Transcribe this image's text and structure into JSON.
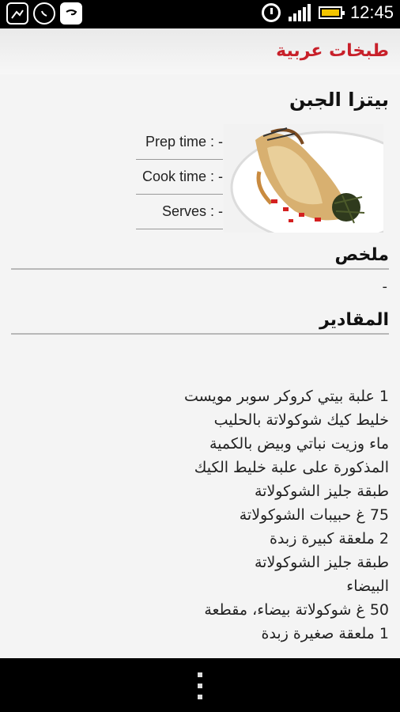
{
  "status_bar": {
    "time": "12:45",
    "icons": [
      "gallery-icon",
      "whatsapp-icon",
      "chat-icon",
      "alarm-icon",
      "signal-icon",
      "battery-icon"
    ],
    "battery_color": "#f2c400"
  },
  "app_bar": {
    "title": "طبخات عربية",
    "title_color": "#c8202a"
  },
  "recipe": {
    "title": "بيتزا الجبن",
    "prep_time": "Prep time : -",
    "cook_time": "Cook time : -",
    "serves": "Serves : -"
  },
  "summary": {
    "header": "ملخص",
    "text": "-"
  },
  "ingredients": {
    "header": "المقادير",
    "lines": [
      "1 علبة بيتي كروكر سوبر مويست",
      "خليط كيك شوكولاتة بالحليب",
      "ماء وزيت نباتي وبيض بالكمية",
      "المذكورة على علبة خليط الكيك",
      "طبقة جليز الشوكولاتة",
      "75 غ حبيبات الشوكولاتة",
      "2 ملعقة كبيرة زبدة",
      "طبقة جليز الشوكولاتة",
      "البيضاء",
      "50 غ شوكولاتة بيضاء، مقطعة",
      "1 ملعقة صغيرة زبدة"
    ]
  },
  "nav": {
    "menu_icon": "overflow-menu-icon"
  }
}
